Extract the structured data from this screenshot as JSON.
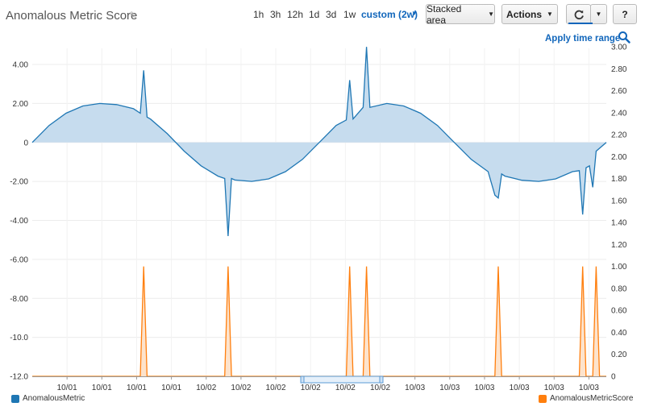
{
  "header": {
    "title": "Anomalous Metric Score",
    "time_ranges": [
      "1h",
      "3h",
      "12h",
      "1d",
      "3d",
      "1w"
    ],
    "custom_range": "custom (2w)",
    "view_select": "Stacked area",
    "actions_label": "Actions",
    "help_label": "?",
    "apply_label": "Apply time range"
  },
  "colors": {
    "metric": "#1f77b4",
    "metric_fill": "#c6dcee",
    "score": "#ff7f0e",
    "score_fill": "#fde3cc",
    "accent": "#1166bb"
  },
  "chart_data": {
    "type": "area",
    "left_axis": {
      "min": -12,
      "max": 4,
      "ticks": [
        "4.00",
        "2.00",
        "0",
        "-2.00",
        "-4.00",
        "-6.00",
        "-8.00",
        "-10.0",
        "-12.0"
      ]
    },
    "right_axis": {
      "min": 0,
      "max": 3,
      "ticks": [
        "3.00",
        "2.80",
        "2.60",
        "2.40",
        "2.20",
        "2.00",
        "1.80",
        "1.60",
        "1.40",
        "1.20",
        "1.00",
        "0.80",
        "0.60",
        "0.40",
        "0.20",
        "0"
      ]
    },
    "x_ticks": [
      "10/01",
      "10/01",
      "10/01",
      "10/01",
      "10/02",
      "10/02",
      "10/02",
      "10/02",
      "10/02",
      "10/02",
      "10/03",
      "10/03",
      "10/03",
      "10/03",
      "10/03",
      "10/03"
    ],
    "legend": [
      "AnomalousMetric",
      "AnomalousMetricScore"
    ],
    "grid": true,
    "series": [
      {
        "name": "AnomalousMetric",
        "axis": "left",
        "x": [
          0,
          0.5,
          1,
          1.5,
          2,
          2.5,
          3,
          3.2,
          3.3,
          3.4,
          3.5,
          4,
          4.5,
          5,
          5.5,
          5.7,
          5.8,
          5.9,
          6,
          6.5,
          7,
          7.5,
          8,
          8.5,
          9,
          9.3,
          9.4,
          9.5,
          9.8,
          9.9,
          10,
          10.5,
          11,
          11.5,
          12,
          12.5,
          13,
          13.5,
          13.7,
          13.8,
          13.9,
          14,
          14.5,
          15,
          15.5,
          16,
          16.2,
          16.3,
          16.4,
          16.5,
          16.6,
          16.7,
          17
        ],
        "values": [
          0,
          0.87,
          1.5,
          1.87,
          2,
          1.94,
          1.73,
          1.5,
          3.7,
          1.3,
          1.2,
          0.45,
          -0.45,
          -1.2,
          -1.73,
          -1.85,
          -4.8,
          -1.85,
          -1.93,
          -2,
          -1.87,
          -1.5,
          -0.87,
          0,
          0.87,
          1.15,
          3.2,
          1.2,
          1.8,
          4.9,
          1.8,
          2,
          1.87,
          1.5,
          0.87,
          0,
          -0.87,
          -1.5,
          -2.7,
          -2.85,
          -1.62,
          -1.73,
          -1.94,
          -2,
          -1.87,
          -1.5,
          -1.45,
          -3.7,
          -1.3,
          -1.2,
          -2.3,
          -0.45,
          0
        ]
      },
      {
        "name": "AnomalousMetricScore",
        "axis": "right",
        "x": [
          0,
          3.2,
          3.3,
          3.4,
          5.7,
          5.8,
          5.9,
          9.3,
          9.4,
          9.5,
          9.8,
          9.9,
          10,
          13.7,
          13.8,
          13.9,
          16.2,
          16.3,
          16.4,
          16.6,
          16.7,
          16.8,
          17
        ],
        "values": [
          0,
          0,
          1,
          0,
          0,
          1,
          0,
          0,
          1,
          0,
          0,
          1,
          0,
          0,
          1,
          0,
          0,
          1,
          0,
          0,
          1,
          0,
          0
        ]
      }
    ]
  }
}
